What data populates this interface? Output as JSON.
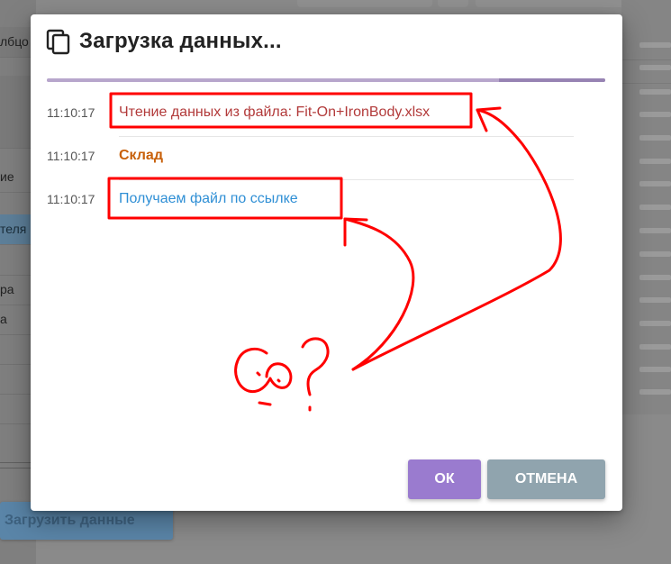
{
  "background": {
    "left_rows": [
      "лбцо",
      "",
      "ие",
      "теля",
      "",
      "ра",
      "а",
      "",
      "",
      ""
    ],
    "load_button_label": "Загрузить данные"
  },
  "dialog": {
    "title": "Загрузка данных...",
    "title_icon": "copy-icon",
    "progress_value": 0.83,
    "log": [
      {
        "time": "11:10:17",
        "message": "Чтение данных из файла: Fit-On+IronBody.xlsx",
        "color": "#b23a3a"
      },
      {
        "time": "11:10:17",
        "message": "Склад",
        "color": "#c8600a"
      },
      {
        "time": "11:10:17",
        "message": "Получаем файл по ссылке",
        "color": "#2f8fd5"
      }
    ],
    "ok_label": "ОК",
    "cancel_label": "ОТМЕНА"
  },
  "colors": {
    "ok_button": "#9a7bcf",
    "cancel_button": "#90a4ae",
    "annotation": "#ff0000"
  }
}
